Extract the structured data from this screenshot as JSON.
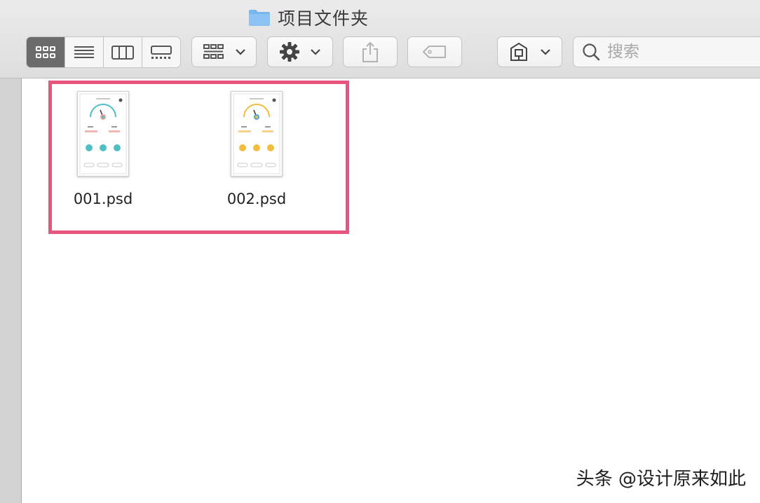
{
  "window": {
    "title": "项目文件夹"
  },
  "toolbar": {
    "view_modes": [
      "icon-view",
      "list-view",
      "column-view",
      "gallery-view"
    ],
    "search": {
      "placeholder": "搜索"
    }
  },
  "files": [
    {
      "name": "001.psd",
      "accent": "#4fbfc4"
    },
    {
      "name": "002.psd",
      "accent": "#f2bd3c"
    }
  ],
  "watermark": "头条 @设计原来如此",
  "colors": {
    "highlight": "#e8557f",
    "folder": "#79b6ee"
  }
}
